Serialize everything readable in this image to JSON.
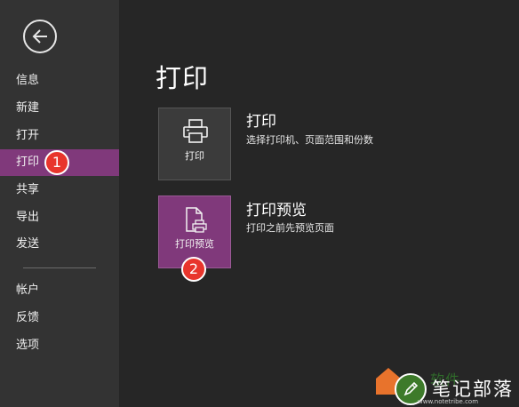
{
  "sidebar": {
    "items": [
      {
        "label": "信息"
      },
      {
        "label": "新建"
      },
      {
        "label": "打开"
      },
      {
        "label": "打印"
      },
      {
        "label": "共享"
      },
      {
        "label": "导出"
      },
      {
        "label": "发送"
      },
      {
        "label": "帐户"
      },
      {
        "label": "反馈"
      },
      {
        "label": "选项"
      }
    ],
    "active_index": 3
  },
  "main": {
    "title": "打印",
    "options": [
      {
        "tile_label": "打印",
        "title": "打印",
        "description": "选择打印机、页面范围和份数",
        "icon": "printer-icon"
      },
      {
        "tile_label": "打印预览",
        "title": "打印预览",
        "description": "打印之前先预览页面",
        "icon": "print-preview-icon"
      }
    ]
  },
  "annotations": {
    "badge_1": "1",
    "badge_2": "2"
  },
  "watermark": {
    "text": "笔记部落",
    "url": "www.notetribe.com",
    "ghost": "软件"
  },
  "colors": {
    "sidebar_bg": "#333333",
    "main_bg": "#262626",
    "accent": "#80397b",
    "badge": "#e8352c"
  }
}
